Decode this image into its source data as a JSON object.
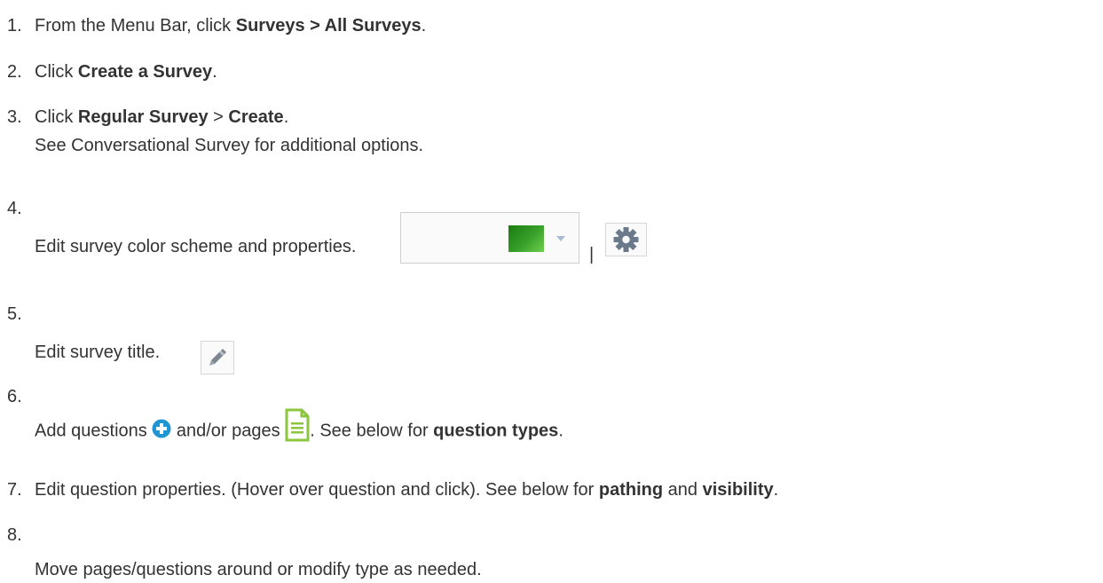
{
  "steps": {
    "s1": {
      "num": "1.",
      "pre": "From the Menu Bar, click ",
      "bold": "Surveys > All Surveys",
      "post": "."
    },
    "s2": {
      "num": "2.",
      "pre": "Click ",
      "bold": "Create a Survey",
      "post": "."
    },
    "s3": {
      "num": "3.",
      "pre": "Click ",
      "bold1": "Regular Survey",
      "mid": " > ",
      "bold2": "Create",
      "post": ".",
      "line2_pre": "See ",
      "line2_link": "Conversational Survey",
      "line2_post": " for additional options."
    },
    "s4": {
      "num": "4.",
      "text": "Edit survey color scheme and properties.",
      "separator": "|"
    },
    "s5": {
      "num": "5.",
      "text": "Edit survey title."
    },
    "s6": {
      "num": "6.",
      "pre": "Add questions ",
      "mid": " and/or pages ",
      "post_pre": ". See below for ",
      "bold": "question types",
      "post": "."
    },
    "s7": {
      "num": "7.",
      "pre": "Edit question properties. (Hover over question and click). See below for ",
      "bold1": "pathing",
      "mid": " and ",
      "bold2": "visibility",
      "post": "."
    },
    "s8": {
      "num": "8.",
      "text": "Move pages/questions around or modify type as needed."
    }
  },
  "icons": {
    "color_scheme": "color-scheme-dropdown-icon",
    "properties": "gear-icon",
    "edit_title": "pencil-icon",
    "add_question": "plus-circle-icon",
    "add_page": "page-icon"
  },
  "colors": {
    "swatch": "#2a8f1d",
    "add_question": "#1f95d4",
    "add_page": "#8cc63f",
    "gear": "#6b7a8a"
  }
}
